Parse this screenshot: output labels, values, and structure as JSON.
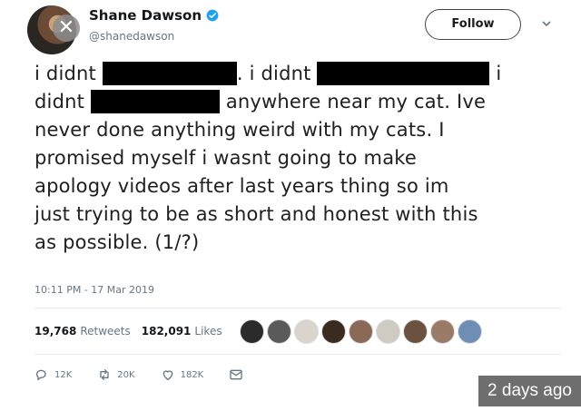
{
  "tweet": {
    "display_name": "Shane Dawson",
    "handle": "@shanedawson",
    "follow_label": "Follow",
    "line1_a": "i didnt",
    "line1_b": ". i didnt",
    "line1_c": "i",
    "line2_a": "didnt",
    "line2_b": "anywhere near my cat. Ive",
    "line3": "never done anything weird with my cats. I",
    "line4": "promised myself i wasnt going to make",
    "line5": "apology videos after last years thing so im",
    "line6": "just trying to be as short and honest with this",
    "line7": "as possible. (1/?)",
    "timestamp": "10:11 PM - 17 Mar 2019"
  },
  "stats": {
    "retweets_count": "19,768",
    "retweets_label": "Retweets",
    "likes_count": "182,091",
    "likes_label": "Likes"
  },
  "actions": {
    "replies": "12K",
    "retweets": "20K",
    "likes": "182K"
  },
  "overlay": {
    "badge": "2 days ago"
  },
  "colors": {
    "verified": "#1da1f2",
    "secondary_text": "#657786",
    "redaction": "#000000"
  }
}
